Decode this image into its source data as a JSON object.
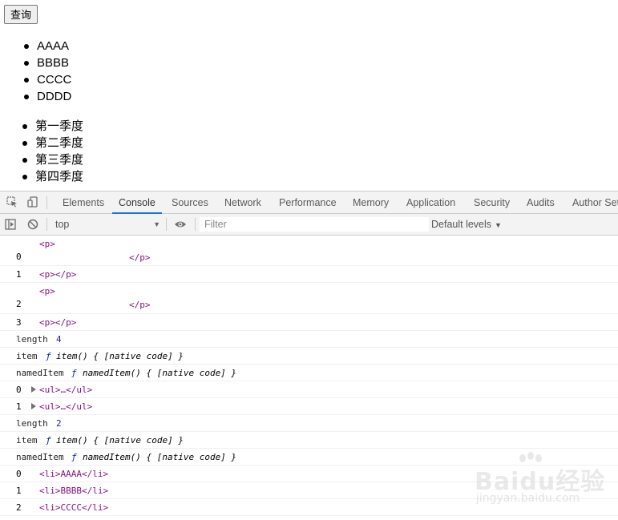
{
  "page": {
    "query_button": "查询",
    "list1": [
      "AAAA",
      "BBBB",
      "CCCC",
      "DDDD"
    ],
    "list2": [
      "第一季度",
      "第二季度",
      "第三季度",
      "第四季度"
    ]
  },
  "devtools": {
    "tabs": [
      "Elements",
      "Console",
      "Sources",
      "Network",
      "Performance",
      "Memory",
      "Application",
      "Security",
      "Audits",
      "Author Set"
    ],
    "active_tab": "Console",
    "context": "top",
    "filter_placeholder": "Filter",
    "levels": "Default levels"
  },
  "console": {
    "p_open": "<p>",
    "p_close": "</p>",
    "p_empty": "<p></p>",
    "idx0": "0",
    "idx1": "1",
    "idx2": "2",
    "idx3": "3",
    "length_label": "length",
    "length1": "4",
    "length2": "2",
    "item_label": "item",
    "item_fn": "item() { [native code] }",
    "nameditem_label": "namedItem",
    "nameditem_fn": "namedItem() { [native code] }",
    "f_symbol": "ƒ",
    "ul_collapsed": "<ul>…</ul>",
    "li_aaaa": "<li>AAAA</li>",
    "li_bbbb": "<li>BBBB</li>",
    "li_cccc": "<li>CCCC</li>"
  },
  "watermark": {
    "brand": "Baidu经验",
    "url": "jingyan.baidu.com"
  }
}
